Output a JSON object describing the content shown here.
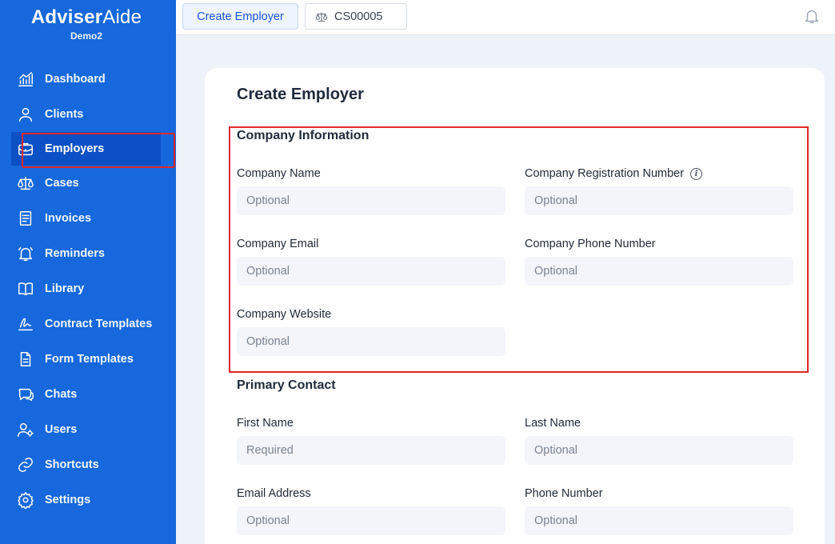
{
  "brand": {
    "name_bold": "Adviser",
    "name_light": "Aide",
    "subtitle": "Demo2"
  },
  "sidebar": {
    "items": [
      {
        "label": "Dashboard",
        "icon": "chart-icon"
      },
      {
        "label": "Clients",
        "icon": "user-icon"
      },
      {
        "label": "Employers",
        "icon": "briefcase-icon",
        "active": true
      },
      {
        "label": "Cases",
        "icon": "scales-icon"
      },
      {
        "label": "Invoices",
        "icon": "invoice-icon"
      },
      {
        "label": "Reminders",
        "icon": "bell-icon"
      },
      {
        "label": "Library",
        "icon": "book-icon"
      },
      {
        "label": "Contract Templates",
        "icon": "signature-icon"
      },
      {
        "label": "Form Templates",
        "icon": "document-icon"
      },
      {
        "label": "Chats",
        "icon": "chat-icon"
      },
      {
        "label": "Users",
        "icon": "users-gear-icon"
      },
      {
        "label": "Shortcuts",
        "icon": "link-icon"
      },
      {
        "label": "Settings",
        "icon": "gear-icon"
      }
    ]
  },
  "topbar": {
    "tabs": [
      {
        "label": "Create Employer",
        "active": true
      },
      {
        "label": "CS00005",
        "icon": "scales-icon"
      }
    ],
    "notification_icon": "bell-icon"
  },
  "main": {
    "title": "Create Employer",
    "company_section": {
      "title": "Company Information",
      "company_name": {
        "label": "Company Name",
        "placeholder": "Optional"
      },
      "registration_number": {
        "label": "Company Registration Number",
        "placeholder": "Optional",
        "info_icon": "info-icon"
      },
      "email": {
        "label": "Company Email",
        "placeholder": "Optional"
      },
      "phone": {
        "label": "Company Phone Number",
        "placeholder": "Optional"
      },
      "website": {
        "label": "Company Website",
        "placeholder": "Optional"
      }
    },
    "contact_section": {
      "title": "Primary Contact",
      "first_name": {
        "label": "First Name",
        "placeholder": "Required"
      },
      "last_name": {
        "label": "Last Name",
        "placeholder": "Optional"
      },
      "email": {
        "label": "Email Address",
        "placeholder": "Optional"
      },
      "phone": {
        "label": "Phone Number",
        "placeholder": "Optional"
      }
    }
  },
  "colors": {
    "sidebar": "#1668dc",
    "active_item": "#0b50c4",
    "highlight": "#e32727",
    "accent": "#1a56db"
  }
}
